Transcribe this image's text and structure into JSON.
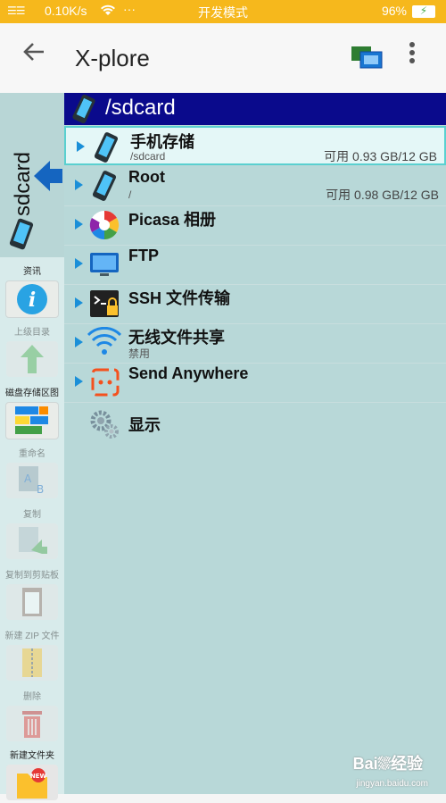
{
  "status_bar": {
    "signal": "☰☰",
    "network_speed": "0.10K/s",
    "dots": "···",
    "mode": "开发模式",
    "battery": "96%"
  },
  "app_bar": {
    "title": "X-plore"
  },
  "left_panel": {
    "tab_label": "sdcard",
    "tools": [
      {
        "label": "资讯",
        "icon": "info-icon"
      },
      {
        "label": "上级目录",
        "icon": "up-arrow-icon"
      },
      {
        "label": "磁盘存储区图",
        "icon": "disk-map-icon"
      },
      {
        "label": "重命名",
        "icon": "rename-icon"
      },
      {
        "label": "复制",
        "icon": "copy-icon"
      },
      {
        "label": "复制到剪贴板",
        "icon": "clipboard-icon"
      },
      {
        "label": "新建 ZIP 文件",
        "icon": "zip-icon"
      },
      {
        "label": "删除",
        "icon": "trash-icon"
      },
      {
        "label": "新建文件夹",
        "icon": "new-folder-icon"
      }
    ]
  },
  "path_bar": {
    "path": "/sdcard"
  },
  "entries": [
    {
      "name": "手机存储",
      "sub": "/sdcard",
      "free": "可用 0.93 GB/12 GB",
      "icon": "phone-icon"
    },
    {
      "name": "Root",
      "sub": "/",
      "free": "可用 0.98 GB/12 GB",
      "icon": "phone-icon"
    },
    {
      "name": "Picasa 相册",
      "sub": "",
      "free": "",
      "icon": "picasa-icon"
    },
    {
      "name": "FTP",
      "sub": "",
      "free": "",
      "icon": "monitor-icon"
    },
    {
      "name": "SSH 文件传输",
      "sub": "",
      "free": "",
      "icon": "terminal-lock-icon"
    },
    {
      "name": "无线文件共享",
      "sub": "禁用",
      "free": "",
      "icon": "wifi-icon"
    },
    {
      "name": "Send Anywhere",
      "sub": "",
      "free": "",
      "icon": "send-anywhere-icon"
    },
    {
      "name": "显示",
      "sub": "",
      "free": "",
      "icon": "gears-icon"
    }
  ],
  "watermark": {
    "brand": "Bai⛆经验",
    "url": "jingyan.baidu.com"
  },
  "colors": {
    "status_bar": "#f6b81c",
    "path_bar": "#0a0a8c",
    "panel_bg": "#b8d8d8",
    "accent": "#1a8fd8"
  }
}
